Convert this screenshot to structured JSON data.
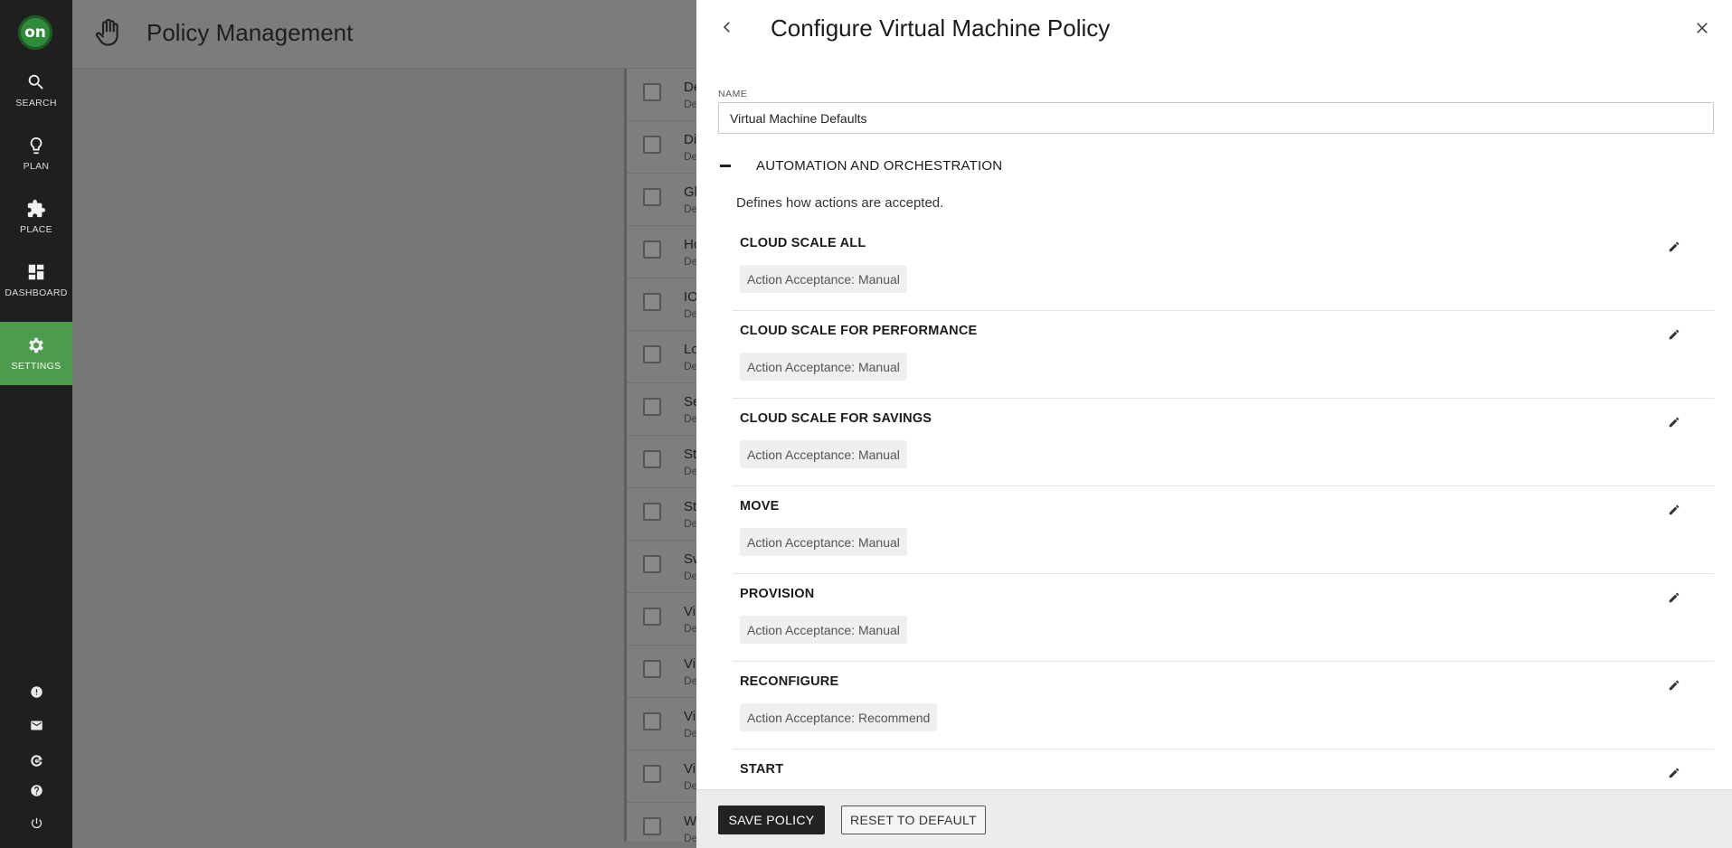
{
  "nav": {
    "logo_text": "on",
    "items": [
      {
        "label": "SEARCH",
        "icon": "search-icon"
      },
      {
        "label": "PLAN",
        "icon": "lightbulb-icon"
      },
      {
        "label": "PLACE",
        "icon": "puzzle-icon"
      },
      {
        "label": "DASHBOARD",
        "icon": "dashboard-icon"
      },
      {
        "label": "SETTINGS",
        "icon": "gear-icon",
        "active": true
      }
    ],
    "bottom_icons": [
      "alert-icon",
      "mail-icon",
      "google-icon",
      "help-icon",
      "power-icon"
    ]
  },
  "page": {
    "title": "Policy Management",
    "icon": "hand-icon",
    "list_rows": [
      {
        "t1": "De",
        "t2": "De"
      },
      {
        "t1": "Di",
        "t2": "De"
      },
      {
        "t1": "Gl",
        "t2": "De"
      },
      {
        "t1": "Ho",
        "t2": "De"
      },
      {
        "t1": "IO",
        "t2": "De"
      },
      {
        "t1": "Lo",
        "t2": "De"
      },
      {
        "t1": "Se",
        "t2": "De"
      },
      {
        "t1": "St",
        "t2": "De"
      },
      {
        "t1": "St",
        "t2": "De"
      },
      {
        "t1": "Sw",
        "t2": "De"
      },
      {
        "t1": "Vi",
        "t2": "De"
      },
      {
        "t1": "Vi",
        "t2": "De"
      },
      {
        "t1": "Vi",
        "t2": "De"
      },
      {
        "t1": "Vi",
        "t2": "De"
      },
      {
        "t1": "W",
        "t2": "De"
      }
    ]
  },
  "drawer": {
    "title": "Configure Virtual Machine Policy",
    "name_label": "NAME",
    "name_value": "Virtual Machine Defaults",
    "section": {
      "title": "AUTOMATION AND ORCHESTRATION",
      "description": "Defines how actions are accepted."
    },
    "settings": [
      {
        "title": "CLOUD SCALE ALL",
        "value": "Action Acceptance: Manual"
      },
      {
        "title": "CLOUD SCALE FOR PERFORMANCE",
        "value": "Action Acceptance: Manual"
      },
      {
        "title": "CLOUD SCALE FOR SAVINGS",
        "value": "Action Acceptance: Manual"
      },
      {
        "title": "MOVE",
        "value": "Action Acceptance: Manual"
      },
      {
        "title": "PROVISION",
        "value": "Action Acceptance: Manual"
      },
      {
        "title": "RECONFIGURE",
        "value": "Action Acceptance: Recommend"
      },
      {
        "title": "START",
        "value": ""
      }
    ],
    "footer": {
      "save_label": "SAVE POLICY",
      "reset_label": "RESET TO DEFAULT"
    }
  }
}
